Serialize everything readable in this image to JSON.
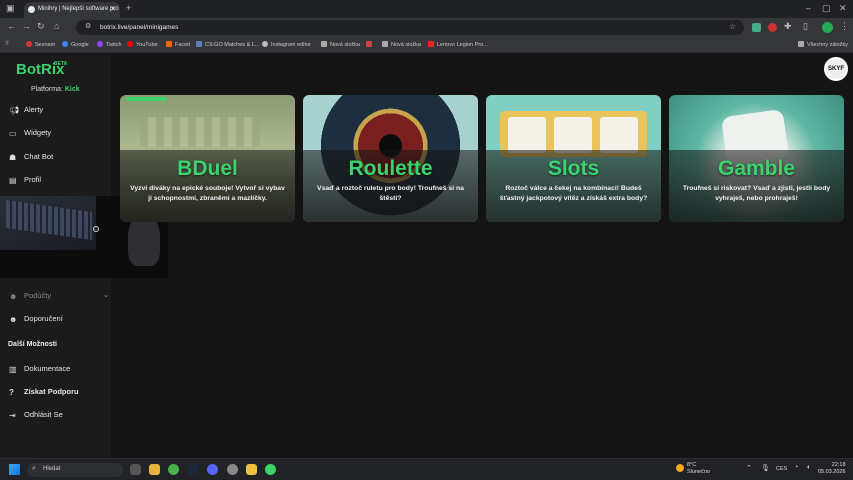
{
  "browser": {
    "tab_title": "Minihry | Nejlepší software pro",
    "url": "botrix.live/panel/minigames",
    "bookmarks": [
      "Seznam",
      "Google",
      "Twitch",
      "YouTube",
      "Faceit",
      "CS:GO Matches & L...",
      "Instagram editor",
      "Nová složka",
      "Nová složka",
      "Lenovo Legion Pro..."
    ],
    "all_bookmarks": "Všechny záložky"
  },
  "app": {
    "logo": "BotRix",
    "logo_badge": "BETA",
    "avatar_label": "SKYF",
    "platform_label": "Platforma:",
    "platform_value": "Kick"
  },
  "sidebar": {
    "items": [
      {
        "label": "Alerty",
        "icon": "megaphone-icon"
      },
      {
        "label": "Widgety",
        "icon": "widgets-icon"
      },
      {
        "label": "Chat Bot",
        "icon": "robot-icon"
      },
      {
        "label": "Profil",
        "icon": "id-card-icon"
      }
    ],
    "group": {
      "label": "Podúčty",
      "icon": "users-icon"
    },
    "referral": {
      "label": "Doporučení",
      "icon": "users-icon"
    },
    "more_title": "Další Možnosti",
    "more_items": [
      {
        "label": "Dokumentace",
        "icon": "book-icon"
      },
      {
        "label": "Získat Podporu",
        "icon": "question-icon"
      },
      {
        "label": "Odhlásit Se",
        "icon": "logout-icon"
      }
    ]
  },
  "games": [
    {
      "title": "BDuel",
      "desc": "Vyzvi diváky na epické souboje! Vytvoř si vybav ji schopnostmi, zbraněmi a mazlíčky."
    },
    {
      "title": "Roulette",
      "desc": "Vsaď a roztoč ruletu pro body! Troufneš si na štěstí?"
    },
    {
      "title": "Slots",
      "desc": "Roztoč válce a čekej na kombinaci! Budeš šťastný jackpotový vítěz a získáš extra body?"
    },
    {
      "title": "Gamble",
      "desc": "Troufneš si riskovat? Vsaď a zjisti, jestli body vyhraješ, nebo prohraješ!"
    }
  ],
  "taskbar": {
    "search_placeholder": "Hledat",
    "weather_temp": "8°C",
    "weather_text": "Slunečno",
    "lang": "CES",
    "time": "22:18",
    "date": "05.03.2026"
  },
  "colors": {
    "accent": "#3bd36b",
    "sidebar_bg": "#1b1b1b",
    "page_bg": "#141414"
  }
}
